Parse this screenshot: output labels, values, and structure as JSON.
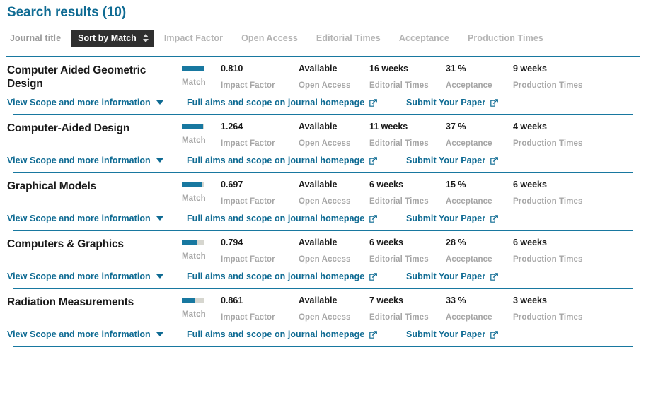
{
  "header": {
    "title": "Search results (10)"
  },
  "sortbar": {
    "label": "Journal title",
    "selected": "Sort by Match",
    "stepper_icon": "stepper-up-down-icon",
    "options": [
      "Impact Factor",
      "Open Access",
      "Editorial Times",
      "Acceptance",
      "Production Times"
    ]
  },
  "columns": {
    "match": "Match",
    "impact_factor": "Impact Factor",
    "open_access": "Open Access",
    "editorial_times": "Editorial Times",
    "acceptance": "Acceptance",
    "production_times": "Production Times"
  },
  "links": {
    "view_scope": "View Scope and more information",
    "caret_icon": "chevron-down-icon",
    "full_aims": "Full aims and scope on journal homepage",
    "submit": "Submit Your Paper",
    "external_icon": "external-link-icon"
  },
  "colors": {
    "accent": "#0f6b93",
    "divider": "#1878a0",
    "bar_fill": "#1878a0",
    "bar_track": "#d6d6cf",
    "caption": "#a6a6a6",
    "select_bg": "#2f2f2f"
  },
  "results": [
    {
      "title": "Computer Aided Geometric Design",
      "match_percent": 100,
      "impact_factor": "0.810",
      "open_access": "Available",
      "editorial_times": "16 weeks",
      "acceptance": "31 %",
      "production_times": "9 weeks"
    },
    {
      "title": "Computer-Aided Design",
      "match_percent": 95,
      "impact_factor": "1.264",
      "open_access": "Available",
      "editorial_times": "11 weeks",
      "acceptance": "37 %",
      "production_times": "4 weeks"
    },
    {
      "title": "Graphical Models",
      "match_percent": 88,
      "impact_factor": "0.697",
      "open_access": "Available",
      "editorial_times": "6 weeks",
      "acceptance": "15 %",
      "production_times": "6 weeks"
    },
    {
      "title": "Computers & Graphics",
      "match_percent": 70,
      "impact_factor": "0.794",
      "open_access": "Available",
      "editorial_times": "6 weeks",
      "acceptance": "28 %",
      "production_times": "6 weeks"
    },
    {
      "title": "Radiation Measurements",
      "match_percent": 60,
      "impact_factor": "0.861",
      "open_access": "Available",
      "editorial_times": "7 weeks",
      "acceptance": "33 %",
      "production_times": "3 weeks"
    }
  ]
}
